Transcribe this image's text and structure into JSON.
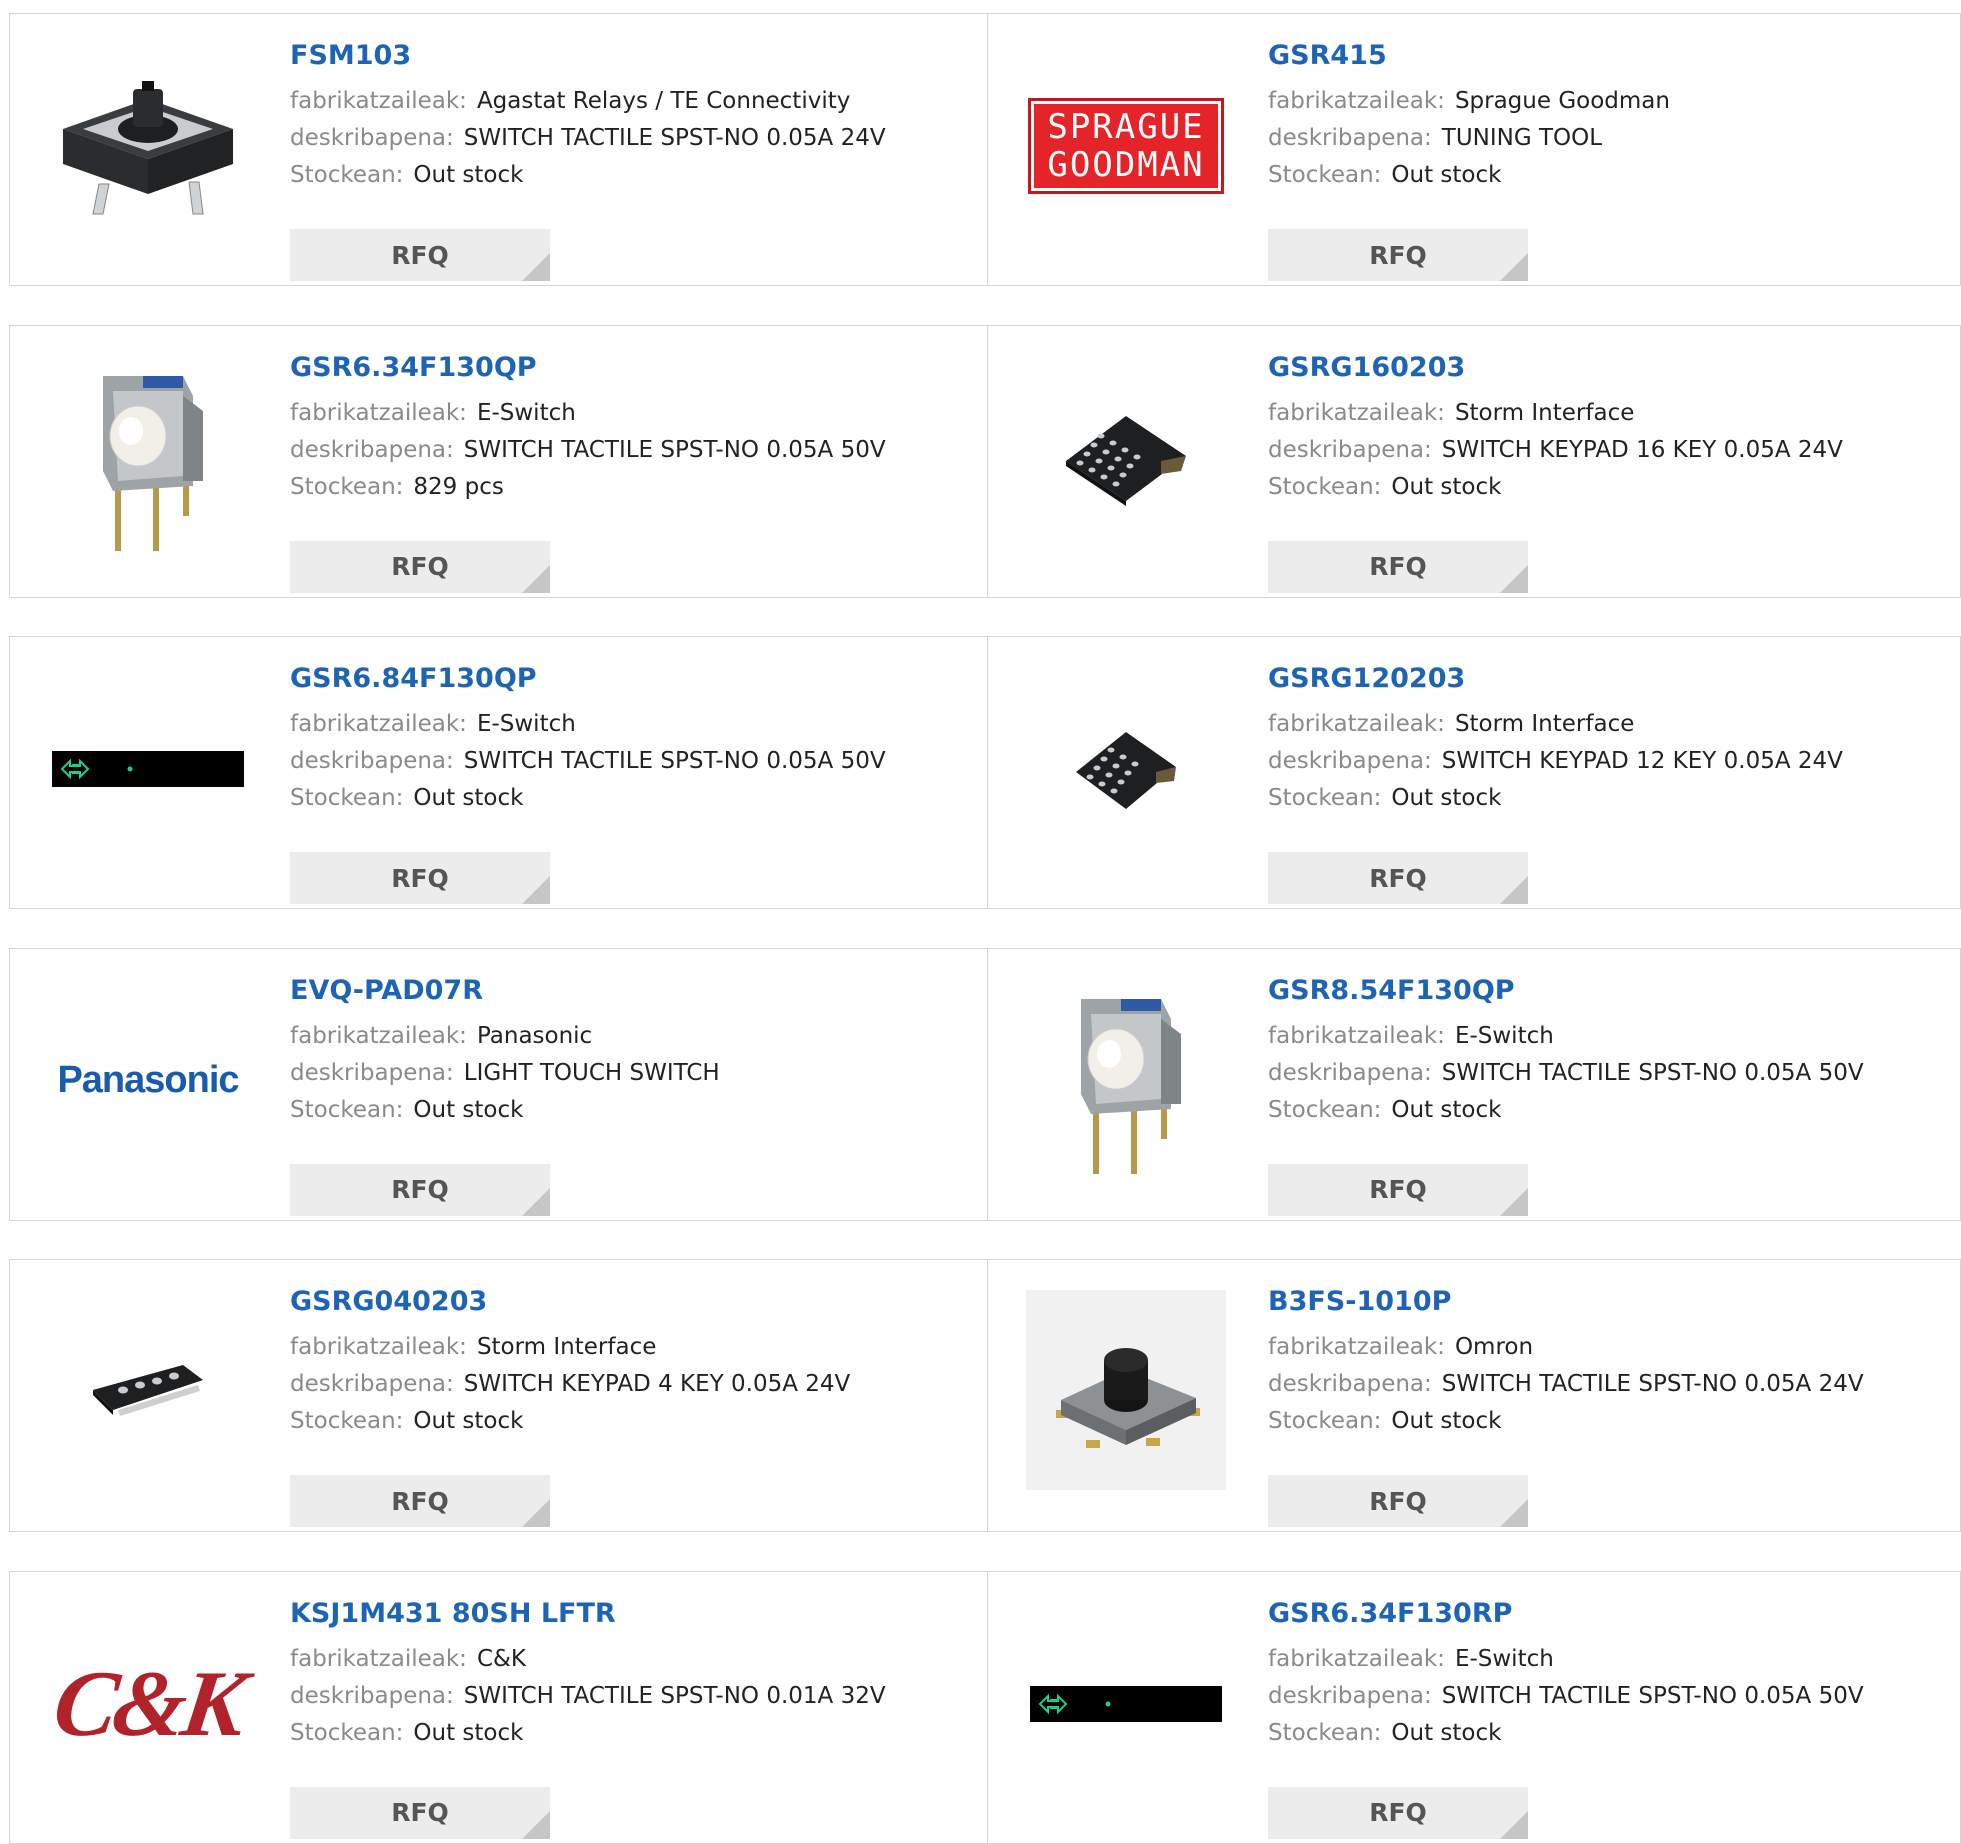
{
  "labels": {
    "manufacturer": "fabrikatzaileak:",
    "description": "deskribapena:",
    "stock": "Stockean:",
    "rfq": "RFQ"
  },
  "colors": {
    "link": "#1e64b4",
    "label": "#8a8a8a",
    "border": "#d6d6d6",
    "button_bg": "#ececec"
  },
  "rows": [
    {
      "left": {
        "part": "FSM103",
        "manufacturer": "Agastat Relays / TE Connectivity",
        "description": "SWITCH TACTILE SPST-NO 0.05A 24V",
        "stock": "Out stock",
        "image": "tactile-switch-square"
      },
      "right": {
        "part": "GSR415",
        "manufacturer": "Sprague Goodman",
        "description": "TUNING TOOL",
        "stock": "Out stock",
        "image": "sprague-goodman-logo",
        "logo_lines": [
          "SPRAGUE",
          "GOODMAN"
        ]
      }
    },
    {
      "left": {
        "part": "GSR6.34F130QP",
        "manufacturer": "E-Switch",
        "description": "SWITCH TACTILE SPST-NO 0.05A 50V",
        "stock": "829 pcs",
        "image": "right-angle-switch"
      },
      "right": {
        "part": "GSRG160203",
        "manufacturer": "Storm Interface",
        "description": "SWITCH KEYPAD 16 KEY 0.05A 24V",
        "stock": "Out stock",
        "image": "keypad-16"
      }
    },
    {
      "left": {
        "part": "GSR6.84F130QP",
        "manufacturer": "E-Switch",
        "description": "SWITCH TACTILE SPST-NO 0.05A 50V",
        "stock": "Out stock",
        "image": "placeholder-strip"
      },
      "right": {
        "part": "GSRG120203",
        "manufacturer": "Storm Interface",
        "description": "SWITCH KEYPAD 12 KEY 0.05A 24V",
        "stock": "Out stock",
        "image": "keypad-12"
      }
    },
    {
      "left": {
        "part": "EVQ-PAD07R",
        "manufacturer": "Panasonic",
        "description": "LIGHT TOUCH SWITCH",
        "stock": "Out stock",
        "image": "panasonic-logo",
        "logo_text": "Panasonic"
      },
      "right": {
        "part": "GSR8.54F130QP",
        "manufacturer": "E-Switch",
        "description": "SWITCH TACTILE SPST-NO 0.05A 50V",
        "stock": "Out stock",
        "image": "right-angle-switch"
      }
    },
    {
      "left": {
        "part": "GSRG040203",
        "manufacturer": "Storm Interface",
        "description": "SWITCH KEYPAD 4 KEY 0.05A 24V",
        "stock": "Out stock",
        "image": "keypad-4"
      },
      "right": {
        "part": "B3FS-1010P",
        "manufacturer": "Omron",
        "description": "SWITCH TACTILE SPST-NO 0.05A 24V",
        "stock": "Out stock",
        "image": "smd-tactile-switch"
      }
    },
    {
      "left": {
        "part": "KSJ1M431 80SH LFTR",
        "manufacturer": "C&K",
        "description": "SWITCH TACTILE SPST-NO 0.01A 32V",
        "stock": "Out stock",
        "image": "ck-logo",
        "logo_text": "C&K"
      },
      "right": {
        "part": "GSR6.34F130RP",
        "manufacturer": "E-Switch",
        "description": "SWITCH TACTILE SPST-NO 0.05A 50V",
        "stock": "Out stock",
        "image": "placeholder-strip"
      }
    }
  ]
}
